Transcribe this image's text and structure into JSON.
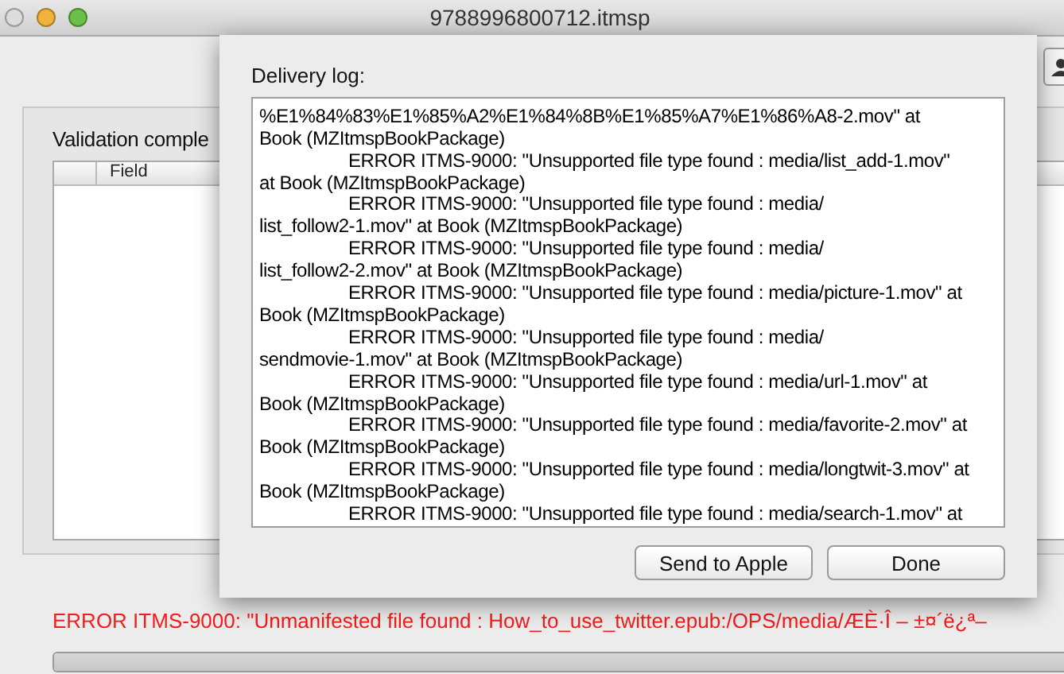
{
  "window": {
    "title": "9788996800712.itmsp"
  },
  "validation": {
    "heading": "Validation comple",
    "table": {
      "columns": [
        "Field"
      ]
    }
  },
  "error_message": "ERROR ITMS-9000: \"Unmanifested file found : How_to_use_twitter.epub:/OPS/media/ÆÈ·Î – ±¤´ë¿ª–",
  "progress": {
    "level": 1
  },
  "sheet": {
    "label": "Delivery log:",
    "log_continued": [
      "%E1%84%83%E1%85%A2%E1%84%8B%E1%85%A7%E1%86%A8-2.mov\" at",
      "Book (MZItmspBookPackage)"
    ],
    "log_entries": [
      [
        "ERROR ITMS-9000: \"Unsupported file type found : media/list_add-1.mov\"",
        "at Book (MZItmspBookPackage)"
      ],
      [
        "ERROR ITMS-9000: \"Unsupported file type found : media/",
        "list_follow2-1.mov\" at Book (MZItmspBookPackage)"
      ],
      [
        "ERROR ITMS-9000: \"Unsupported file type found : media/",
        "list_follow2-2.mov\" at Book (MZItmspBookPackage)"
      ],
      [
        "ERROR ITMS-9000: \"Unsupported file type found : media/picture-1.mov\" at",
        "Book (MZItmspBookPackage)"
      ],
      [
        "ERROR ITMS-9000: \"Unsupported file type found : media/",
        "sendmovie-1.mov\" at Book (MZItmspBookPackage)"
      ],
      [
        "ERROR ITMS-9000: \"Unsupported file type found : media/url-1.mov\" at",
        "Book (MZItmspBookPackage)"
      ],
      [
        "ERROR ITMS-9000: \"Unsupported file type found : media/favorite-2.mov\" at",
        "Book (MZItmspBookPackage)"
      ],
      [
        "ERROR ITMS-9000: \"Unsupported file type found : media/longtwit-3.mov\" at",
        "Book (MZItmspBookPackage)"
      ],
      [
        "ERROR ITMS-9000: \"Unsupported file type found : media/search-1.mov\" at"
      ]
    ],
    "buttons": [
      "Send to Apple",
      "Done"
    ]
  }
}
